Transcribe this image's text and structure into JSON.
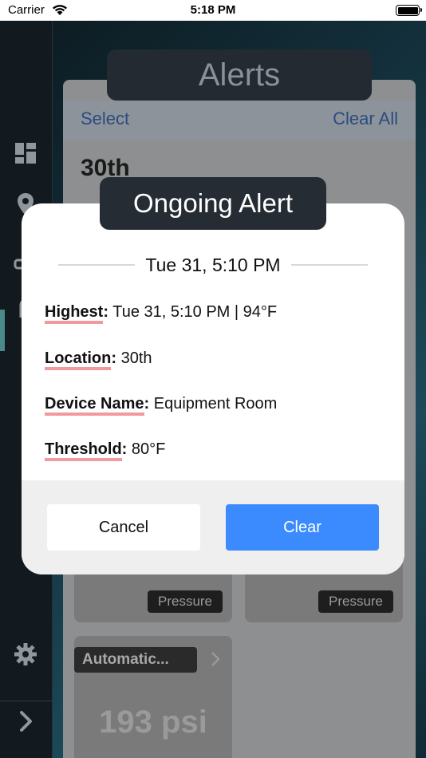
{
  "status_bar": {
    "carrier": "Carrier",
    "time": "5:18 PM"
  },
  "sidebar": {
    "items": [
      "dashboard-icon",
      "location-pin-icon",
      "device-icon",
      "alert-bell-icon"
    ],
    "settings_icon": "gear-icon",
    "expand_icon": "chevron-right-icon"
  },
  "header": {
    "title": "Alerts"
  },
  "toolbar": {
    "select_label": "Select",
    "clear_all_label": "Clear All"
  },
  "list": {
    "section_title": "30th",
    "cards": [
      {
        "type_label": "Pressure"
      },
      {
        "type_label": "Pressure"
      },
      {
        "name": "Automatic...",
        "value": "193 psi"
      }
    ]
  },
  "modal": {
    "title": "Ongoing Alert",
    "date": "Tue 31, 5:10 PM",
    "fields": [
      {
        "label": "Highest",
        "value": "Tue 31, 5:10 PM | 94°F"
      },
      {
        "label": "Location",
        "value": "30th"
      },
      {
        "label": "Device Name",
        "value": "Equipment Room"
      },
      {
        "label": "Threshold",
        "value": "80°F"
      }
    ],
    "cancel_label": "Cancel",
    "clear_label": "Clear"
  },
  "colors": {
    "accent": "#3b8bff",
    "underline": "#f09aa0",
    "title_bg": "#262c34"
  }
}
